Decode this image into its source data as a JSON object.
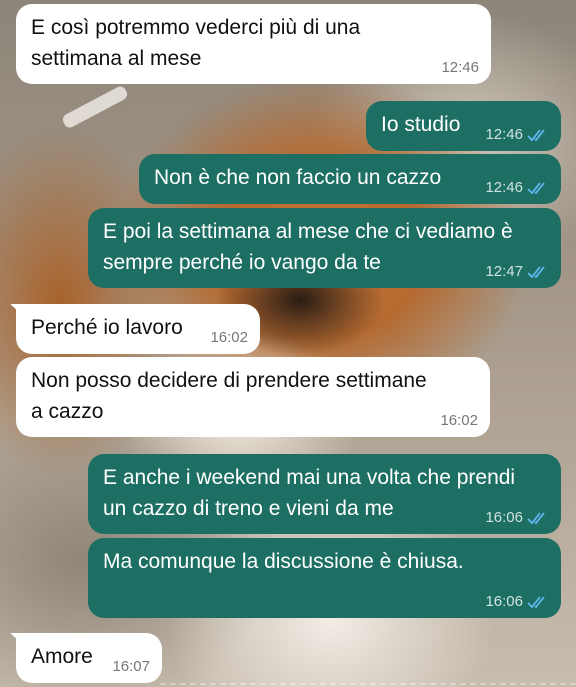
{
  "messages": [
    {
      "dir": "in",
      "text": "E così potremmo vederci più di una\nsettimana al mese",
      "time": "12:46"
    },
    {
      "dir": "out",
      "text": "Io studio",
      "time": "12:46"
    },
    {
      "dir": "out",
      "text": "Non è che non faccio un cazzo",
      "time": "12:46"
    },
    {
      "dir": "out",
      "text": "E poi la settimana al mese che ci vediamo è\nsempre perché io vango da te",
      "time": "12:47"
    },
    {
      "dir": "in",
      "text": "Perché io lavoro",
      "time": "16:02"
    },
    {
      "dir": "in",
      "text": "Non posso decidere di prendere settimane\na cazzo",
      "time": "16:02"
    },
    {
      "dir": "out",
      "text": "E anche i weekend mai una volta che prendi\nun cazzo di treno e vieni da me",
      "time": "16:06"
    },
    {
      "dir": "out",
      "text": "Ma comunque la discussione è chiusa.",
      "time": "16:06"
    },
    {
      "dir": "in",
      "text": "Amore",
      "time": "16:07"
    }
  ],
  "colors": {
    "outgoing_bubble": "#1e6f63",
    "incoming_bubble": "#ffffff",
    "read_ticks": "#5fb8f0"
  },
  "icons": {
    "read_receipt": "double-check-icon"
  }
}
